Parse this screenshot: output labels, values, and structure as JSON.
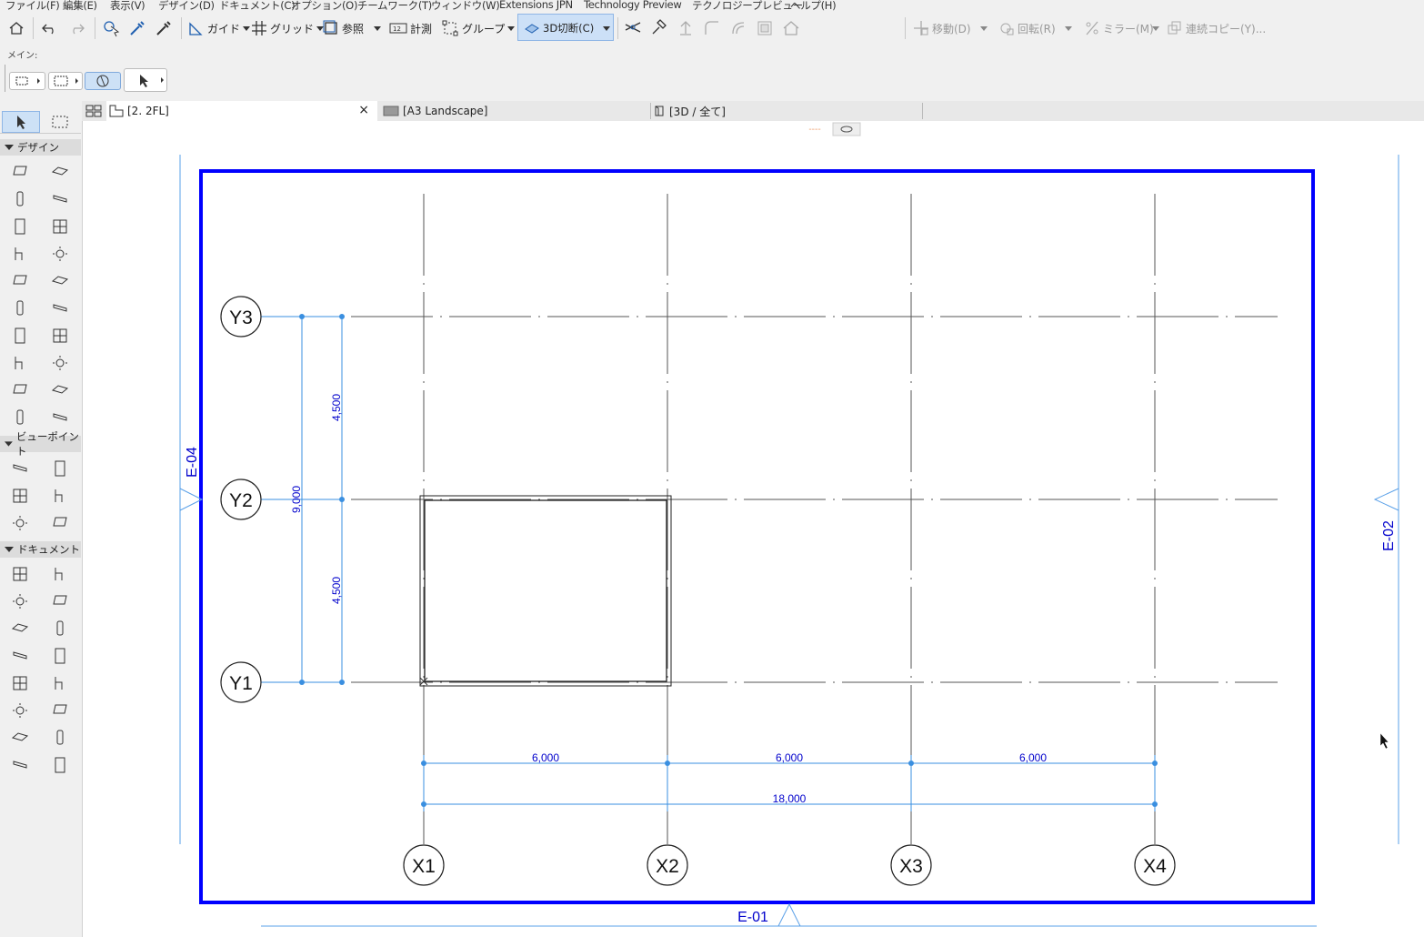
{
  "menu": [
    "ファイル(F)",
    "編集(E)",
    "表示(V)",
    "デザイン(D)",
    "ドキュメント(C)",
    "オプション(O)",
    "チームワーク(T)",
    "ウィンドウ(W)",
    "Extensions JPN",
    "Technology Preview",
    "テクノロジープレビュー",
    "ヘルプ(H)"
  ],
  "toolbar": {
    "guide": "ガイド",
    "grid": "グリッド",
    "reference": "参照",
    "measure": "計測",
    "group": "グループ",
    "cut3d": "3D切断(C)",
    "move": "移動(D)",
    "rotate": "回転(R)",
    "mirror": "ミラー(M)",
    "multiply": "連続コピー(Y)..."
  },
  "infobox": {
    "label": "メイン:"
  },
  "tabs": [
    {
      "label": "[2. 2FL]",
      "active": true,
      "close": "×"
    },
    {
      "label": "[A3 Landscape]",
      "active": false
    },
    {
      "label": "[3D / 全て]",
      "active": false
    }
  ],
  "toolbox": {
    "sections": [
      "デザイン",
      "ビューポイント",
      "ドキュメント"
    ]
  },
  "plan": {
    "grid_x_labels": [
      "X1",
      "X2",
      "X3",
      "X4"
    ],
    "grid_y_labels": [
      "Y3",
      "Y2",
      "Y1"
    ],
    "dim_x_spans": [
      "6,000",
      "6,000",
      "6,000"
    ],
    "dim_x_total": "18,000",
    "dim_y_spans": [
      "4,500",
      "4,500"
    ],
    "dim_y_total": "9,000",
    "elevations": {
      "left": "E-04",
      "right": "E-02",
      "bottom": "E-01"
    },
    "frame_color": "#0000ff",
    "dim_color": "#3a8fe0",
    "dim_text_color": "#0000cc"
  }
}
